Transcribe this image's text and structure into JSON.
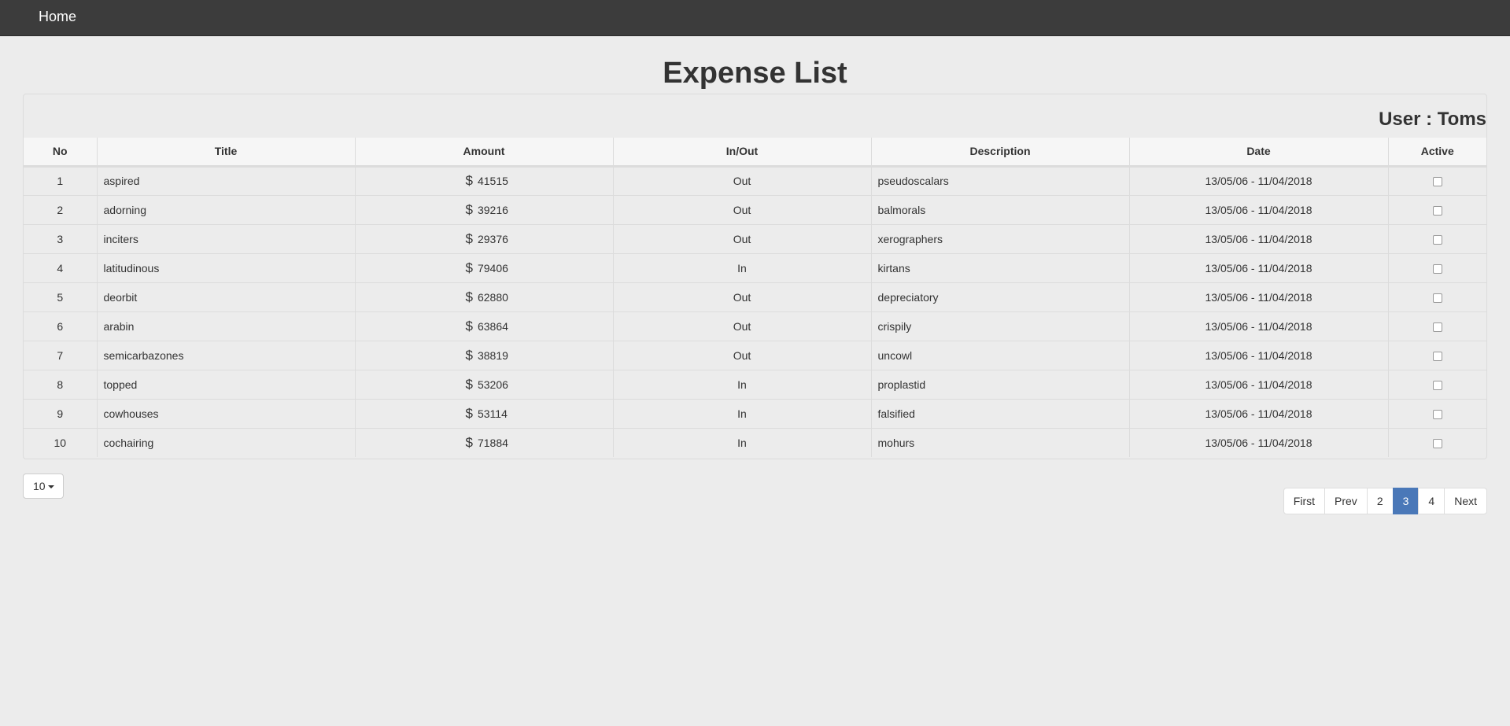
{
  "nav": {
    "brand": "Home"
  },
  "page": {
    "title": "Expense List",
    "user_label": "User : Toms"
  },
  "table": {
    "columns": [
      "No",
      "Title",
      "Amount",
      "In/Out",
      "Description",
      "Date",
      "Active"
    ],
    "currency_symbol": "$",
    "rows": [
      {
        "no": "1",
        "title": "aspired",
        "amount": "41515",
        "inout": "Out",
        "description": "pseudoscalars",
        "date": "13/05/06 - 11/04/2018"
      },
      {
        "no": "2",
        "title": "adorning",
        "amount": "39216",
        "inout": "Out",
        "description": "balmorals",
        "date": "13/05/06 - 11/04/2018"
      },
      {
        "no": "3",
        "title": "inciters",
        "amount": "29376",
        "inout": "Out",
        "description": "xerographers",
        "date": "13/05/06 - 11/04/2018"
      },
      {
        "no": "4",
        "title": "latitudinous",
        "amount": "79406",
        "inout": "In",
        "description": "kirtans",
        "date": "13/05/06 - 11/04/2018"
      },
      {
        "no": "5",
        "title": "deorbit",
        "amount": "62880",
        "inout": "Out",
        "description": "depreciatory",
        "date": "13/05/06 - 11/04/2018"
      },
      {
        "no": "6",
        "title": "arabin",
        "amount": "63864",
        "inout": "Out",
        "description": "crispily",
        "date": "13/05/06 - 11/04/2018"
      },
      {
        "no": "7",
        "title": "semicarbazones",
        "amount": "38819",
        "inout": "Out",
        "description": "uncowl",
        "date": "13/05/06 - 11/04/2018"
      },
      {
        "no": "8",
        "title": "topped",
        "amount": "53206",
        "inout": "In",
        "description": "proplastid",
        "date": "13/05/06 - 11/04/2018"
      },
      {
        "no": "9",
        "title": "cowhouses",
        "amount": "53114",
        "inout": "In",
        "description": "falsified",
        "date": "13/05/06 - 11/04/2018"
      },
      {
        "no": "10",
        "title": "cochairing",
        "amount": "71884",
        "inout": "In",
        "description": "mohurs",
        "date": "13/05/06 - 11/04/2018"
      }
    ]
  },
  "page_size": {
    "value": "10"
  },
  "pagination": {
    "items": [
      {
        "label": "First",
        "active": false
      },
      {
        "label": "Prev",
        "active": false
      },
      {
        "label": "2",
        "active": false
      },
      {
        "label": "3",
        "active": true
      },
      {
        "label": "4",
        "active": false
      },
      {
        "label": "Next",
        "active": false
      }
    ]
  },
  "colors": {
    "navbar": "#3c3c3c",
    "active_page": "#4a78b8",
    "background": "#ececec"
  },
  "icons": {
    "page_size_caret": "caret-down-icon",
    "active_checkbox": "checkbox-icon"
  }
}
